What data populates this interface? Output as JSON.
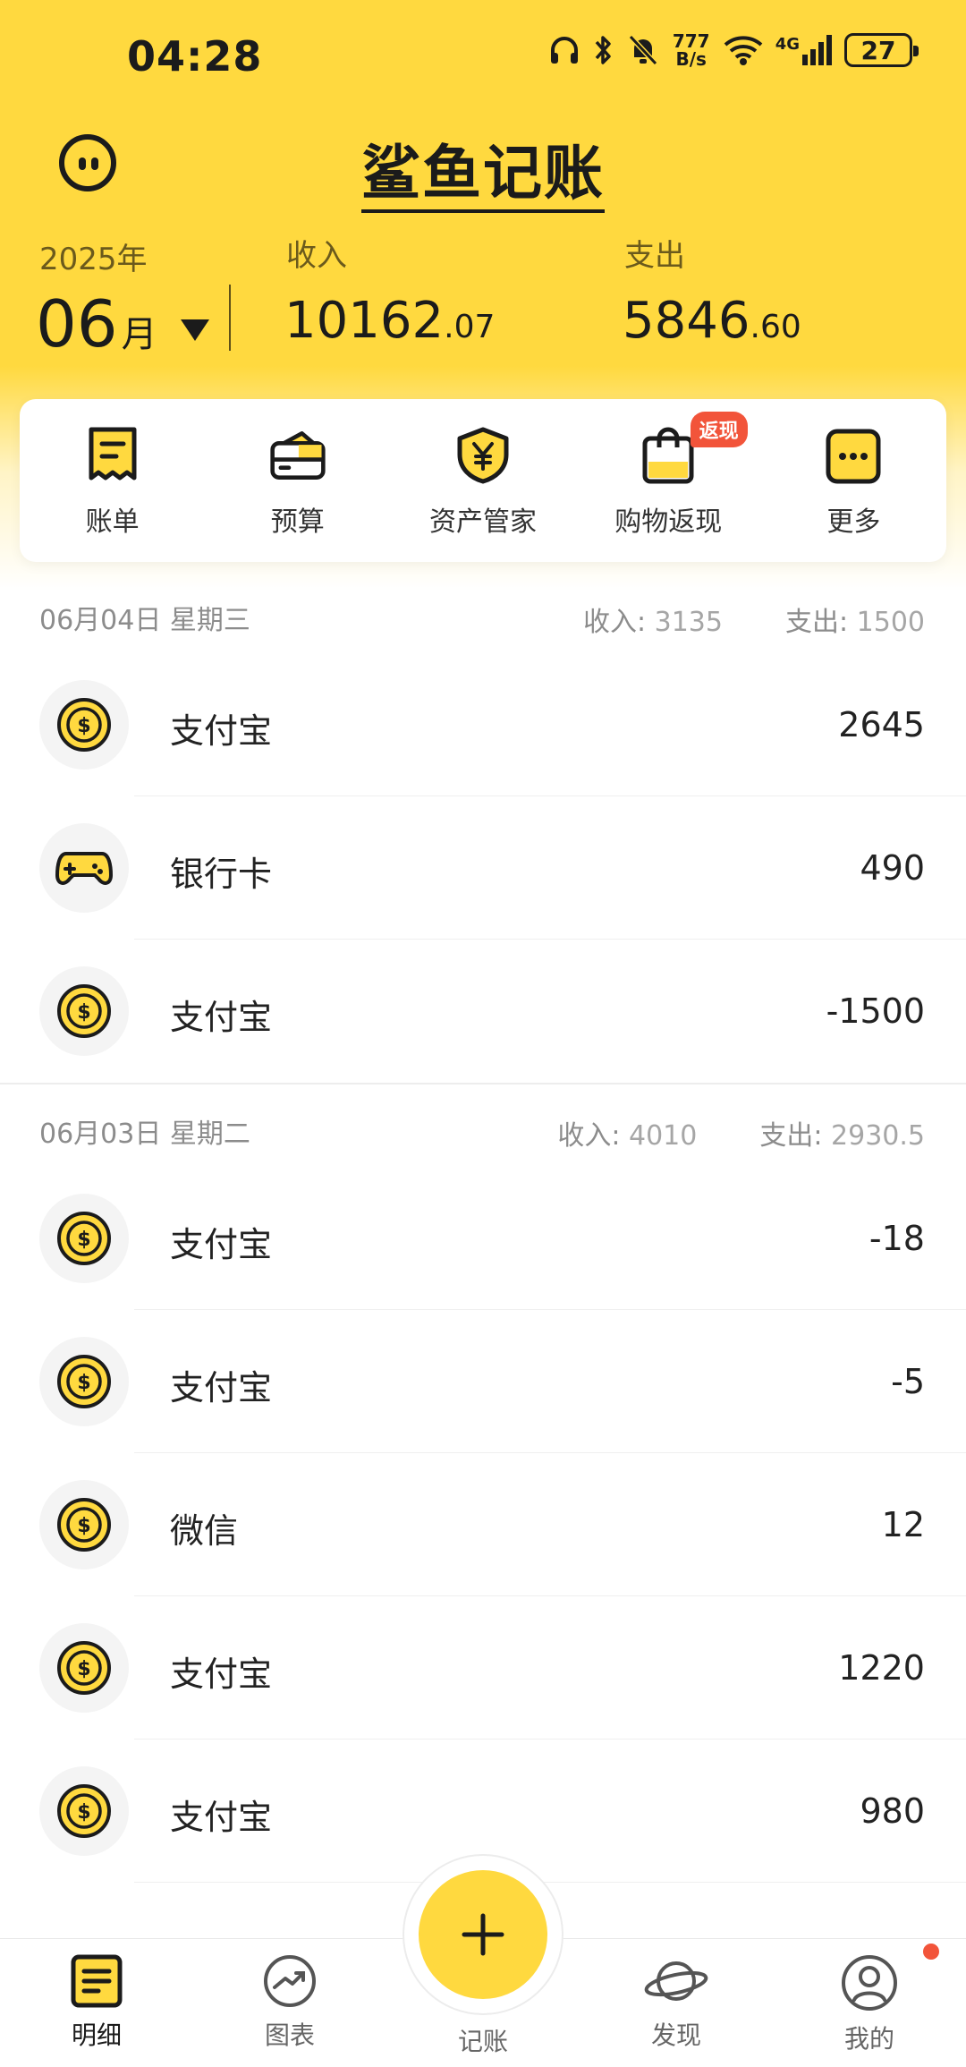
{
  "status_bar": {
    "time": "04:28",
    "net_speed_top": "777",
    "net_speed_unit": "B/s",
    "network": "4G",
    "battery": "27",
    "icons": [
      "headphones-icon",
      "bluetooth-icon",
      "mute-bell-icon",
      "wifi-icon",
      "signal-icon",
      "battery-icon"
    ]
  },
  "header": {
    "app_title": "鲨鱼记账",
    "year": "2025年",
    "month": "06",
    "month_unit": "月",
    "income_label": "收入",
    "income_int": "10162",
    "income_dec": ".07",
    "expense_label": "支出",
    "expense_int": "5846",
    "expense_dec": ".60"
  },
  "actions": [
    {
      "label": "账单",
      "icon": "bill-icon"
    },
    {
      "label": "预算",
      "icon": "wallet-icon"
    },
    {
      "label": "资产管家",
      "icon": "shield-yuan-icon"
    },
    {
      "label": "购物返现",
      "icon": "shopping-bag-icon",
      "badge": "返现"
    },
    {
      "label": "更多",
      "icon": "more-icon"
    }
  ],
  "days": [
    {
      "date": "06月04日 星期三",
      "income_label": "收入:",
      "income": "3135",
      "expense_label": "支出:",
      "expense": "1500",
      "transactions": [
        {
          "name": "支付宝",
          "amount": "2645",
          "icon": "coin-icon"
        },
        {
          "name": "银行卡",
          "amount": "490",
          "icon": "gamepad-icon"
        },
        {
          "name": "支付宝",
          "amount": "-1500",
          "icon": "coin-icon"
        }
      ]
    },
    {
      "date": "06月03日 星期二",
      "income_label": "收入:",
      "income": "4010",
      "expense_label": "支出:",
      "expense": "2930.5",
      "transactions": [
        {
          "name": "支付宝",
          "amount": "-18",
          "icon": "coin-icon"
        },
        {
          "name": "支付宝",
          "amount": "-5",
          "icon": "coin-icon"
        },
        {
          "name": "微信",
          "amount": "12",
          "icon": "coin-icon"
        },
        {
          "name": "支付宝",
          "amount": "1220",
          "icon": "coin-icon"
        },
        {
          "name": "支付宝",
          "amount": "980",
          "icon": "coin-icon"
        }
      ]
    }
  ],
  "bottom_nav": {
    "items": [
      {
        "label": "明细",
        "icon": "list-icon",
        "active": true
      },
      {
        "label": "图表",
        "icon": "chart-icon",
        "active": false
      },
      {
        "label": "记账",
        "icon": "plus-icon",
        "active": false
      },
      {
        "label": "发现",
        "icon": "planet-icon",
        "active": false
      },
      {
        "label": "我的",
        "icon": "profile-icon",
        "active": false
      }
    ]
  },
  "colors": {
    "brand_yellow": "#FFD93F",
    "badge_red": "#F2543A",
    "text_dark": "#1b1b1b",
    "text_muted": "#8c8c8c"
  }
}
